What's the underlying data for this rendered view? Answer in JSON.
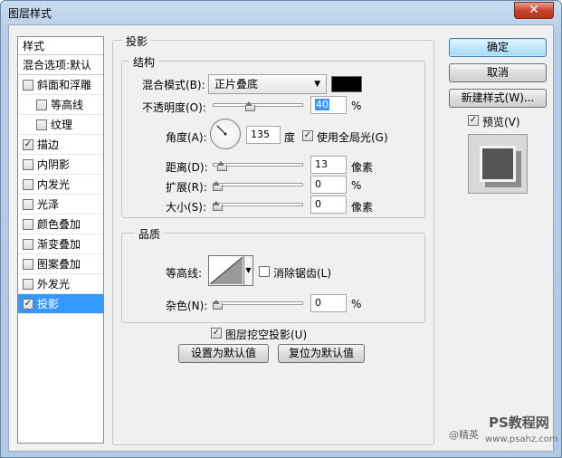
{
  "window": {
    "title": "图层样式",
    "close_symbol": "✕"
  },
  "style_list": {
    "header": "样式",
    "blend_options": "混合选项:默认",
    "items": [
      {
        "label": "斜面和浮雕",
        "checked": false,
        "sub": false
      },
      {
        "label": "等高线",
        "checked": false,
        "sub": true
      },
      {
        "label": "纹理",
        "checked": false,
        "sub": true
      },
      {
        "label": "描边",
        "checked": true,
        "sub": false
      },
      {
        "label": "内阴影",
        "checked": false,
        "sub": false
      },
      {
        "label": "内发光",
        "checked": false,
        "sub": false
      },
      {
        "label": "光泽",
        "checked": false,
        "sub": false
      },
      {
        "label": "颜色叠加",
        "checked": false,
        "sub": false
      },
      {
        "label": "渐变叠加",
        "checked": false,
        "sub": false
      },
      {
        "label": "图案叠加",
        "checked": false,
        "sub": false
      },
      {
        "label": "外发光",
        "checked": false,
        "sub": false
      },
      {
        "label": "投影",
        "checked": true,
        "sub": false,
        "selected": true
      }
    ]
  },
  "panel": {
    "title": "投影",
    "structure": {
      "title": "结构",
      "blend_mode_label": "混合模式(B):",
      "blend_mode_value": "正片叠底",
      "shadow_color": "#000000",
      "opacity_label": "不透明度(O):",
      "opacity_value": "40",
      "opacity_percent": 40,
      "percent_unit": "%",
      "angle_label": "角度(A):",
      "angle_value": "135",
      "angle_degrees": 135,
      "angle_unit": "度",
      "global_light_label": "使用全局光(G)",
      "global_light_checked": true,
      "distance_label": "距离(D):",
      "distance_value": "13",
      "distance_fraction": 0.05,
      "pixel_unit": "像素",
      "spread_label": "扩展(R):",
      "spread_value": "0",
      "spread_fraction": 0,
      "size_label": "大小(S):",
      "size_value": "0",
      "size_fraction": 0
    },
    "quality": {
      "title": "品质",
      "contour_label": "等高线:",
      "antialias_label": "消除锯齿(L)",
      "antialias_checked": false,
      "noise_label": "杂色(N):",
      "noise_value": "0",
      "noise_fraction": 0,
      "percent_unit": "%"
    },
    "knockout_label": "图层挖空投影(U)",
    "knockout_checked": true,
    "make_default": "设置为默认值",
    "reset_default": "复位为默认值"
  },
  "actions": {
    "ok": "确定",
    "cancel": "取消",
    "new_style": "新建样式(W)...",
    "preview_label": "预览(V)",
    "preview_checked": true
  },
  "watermark": {
    "brand": "PS教程网",
    "url": "www.psahz.com",
    "prefix": "@精英"
  },
  "check_mark": "✓",
  "dropdown_arrow": "▼"
}
